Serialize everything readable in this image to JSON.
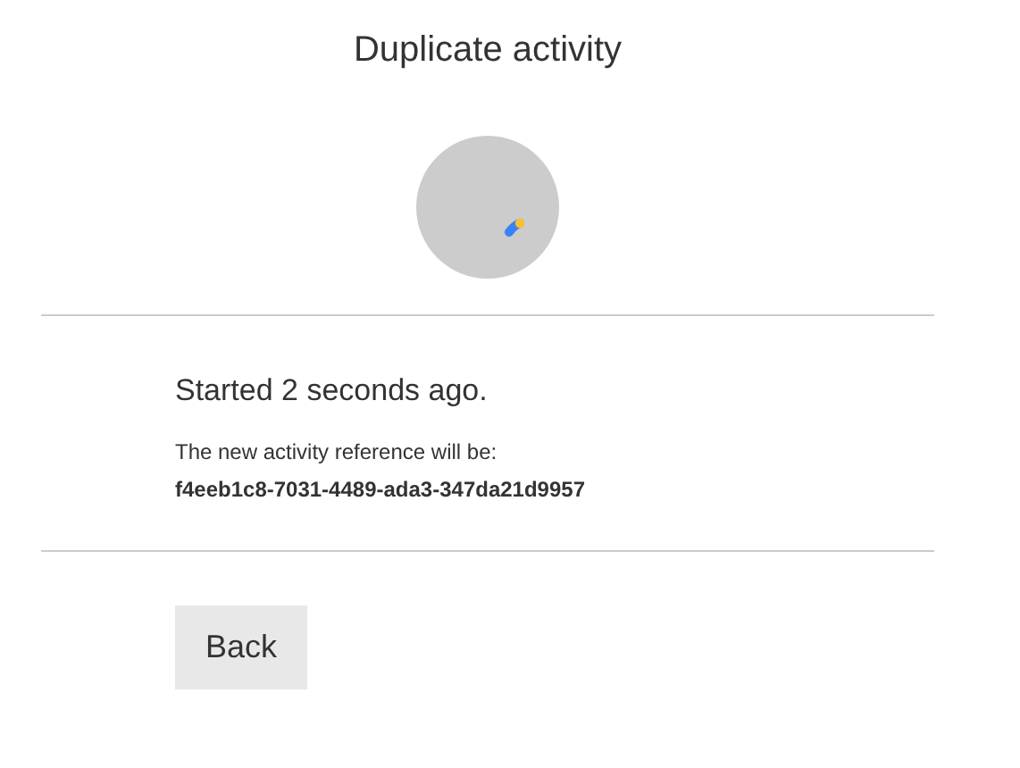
{
  "title": "Duplicate activity",
  "status": "Started 2 seconds ago.",
  "reference_label": "The new activity reference will be:",
  "reference": "f4eeb1c8-7031-4489-ada3-347da21d9957",
  "buttons": [
    {
      "label": "Back"
    }
  ]
}
